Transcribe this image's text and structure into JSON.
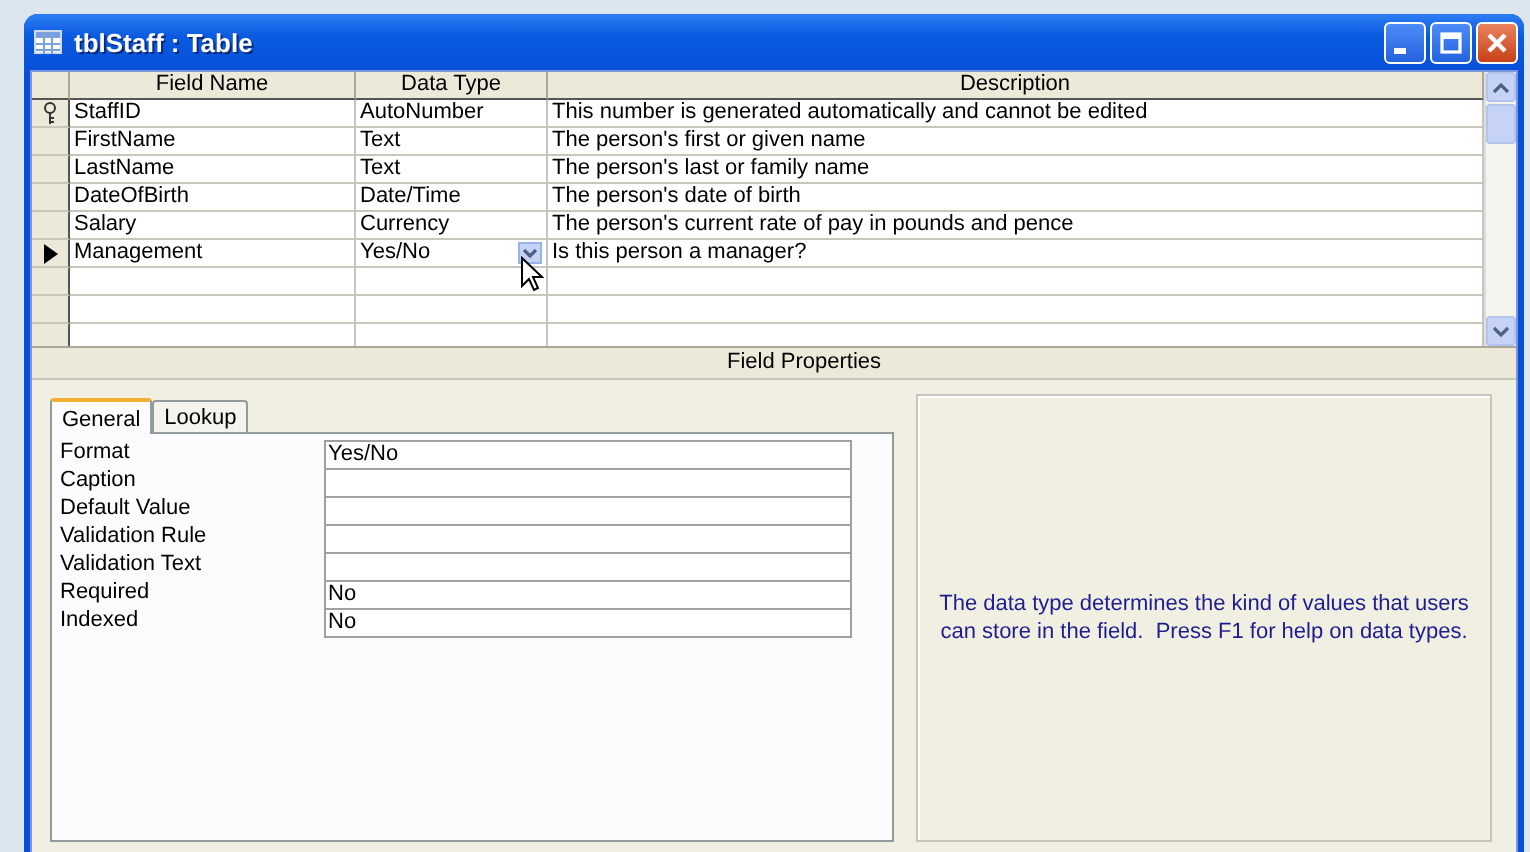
{
  "window": {
    "title": "tblStaff : Table"
  },
  "grid": {
    "columns": [
      "Field Name",
      "Data Type",
      "Description"
    ],
    "rows": [
      {
        "field_name": "StaffID",
        "data_type": "AutoNumber",
        "description": "This number is generated automatically and cannot be edited",
        "primary_key": true,
        "current": false
      },
      {
        "field_name": "FirstName",
        "data_type": "Text",
        "description": "The person's first or given name",
        "primary_key": false,
        "current": false
      },
      {
        "field_name": "LastName",
        "data_type": "Text",
        "description": "The person's last or family name",
        "primary_key": false,
        "current": false
      },
      {
        "field_name": "DateOfBirth",
        "data_type": "Date/Time",
        "description": "The person's date of birth",
        "primary_key": false,
        "current": false
      },
      {
        "field_name": "Salary",
        "data_type": "Currency",
        "description": "The person's current rate of pay in pounds and pence",
        "primary_key": false,
        "current": false
      },
      {
        "field_name": "Management",
        "data_type": "Yes/No",
        "description": "Is this person a manager?",
        "primary_key": false,
        "current": true
      }
    ]
  },
  "field_properties": {
    "title": "Field Properties",
    "tabs": [
      {
        "label": "General",
        "selected": true
      },
      {
        "label": "Lookup",
        "selected": false
      }
    ],
    "properties": [
      {
        "label": "Format",
        "value": "Yes/No"
      },
      {
        "label": "Caption"
      },
      {
        "label": "Default Value"
      },
      {
        "label": "Validation Rule"
      },
      {
        "label": "Validation Text"
      },
      {
        "label": "Required",
        "value": "No"
      },
      {
        "label": "Indexed",
        "value": "No"
      }
    ],
    "help_text": "The data type determines the kind of values that users can store in the field.  Press F1 for help on data types."
  }
}
